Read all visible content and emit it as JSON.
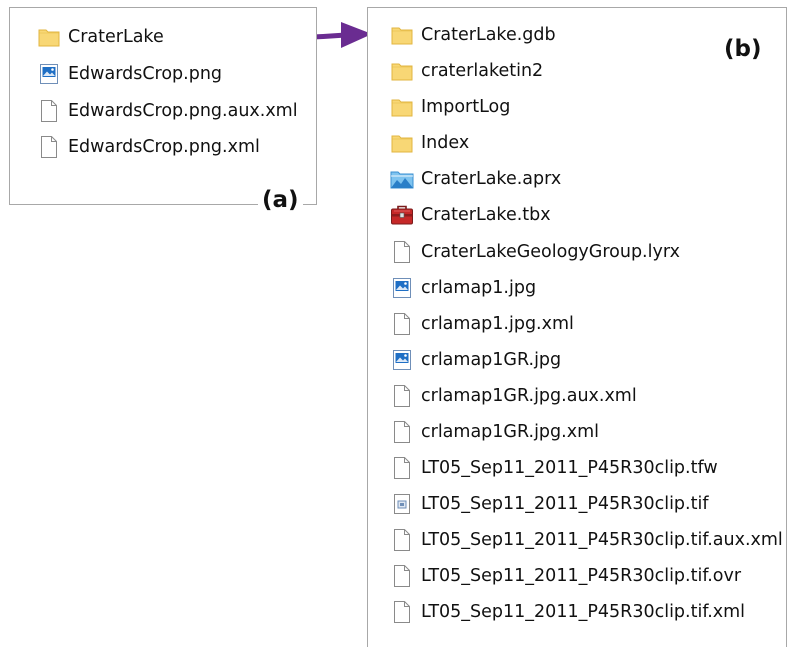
{
  "panel_a": {
    "label": "(a)",
    "items": [
      {
        "name": "CraterLake",
        "icon": "folder-icon"
      },
      {
        "name": "EdwardsCrop.png",
        "icon": "image-file-icon"
      },
      {
        "name": "EdwardsCrop.png.aux.xml",
        "icon": "document-icon"
      },
      {
        "name": "EdwardsCrop.png.xml",
        "icon": "document-icon"
      }
    ]
  },
  "panel_b": {
    "label": "(b)",
    "items": [
      {
        "name": "CraterLake.gdb",
        "icon": "folder-icon"
      },
      {
        "name": "craterlaketin2",
        "icon": "folder-icon"
      },
      {
        "name": "ImportLog",
        "icon": "folder-icon"
      },
      {
        "name": "Index",
        "icon": "folder-icon"
      },
      {
        "name": "CraterLake.aprx",
        "icon": "arcgis-project-icon"
      },
      {
        "name": "CraterLake.tbx",
        "icon": "toolbox-icon"
      },
      {
        "name": "CraterLakeGeologyGroup.lyrx",
        "icon": "document-icon"
      },
      {
        "name": "crlamap1.jpg",
        "icon": "image-file-icon"
      },
      {
        "name": "crlamap1.jpg.xml",
        "icon": "document-icon"
      },
      {
        "name": "crlamap1GR.jpg",
        "icon": "image-file-icon"
      },
      {
        "name": "crlamap1GR.jpg.aux.xml",
        "icon": "document-icon"
      },
      {
        "name": "crlamap1GR.jpg.xml",
        "icon": "document-icon"
      },
      {
        "name": "LT05_Sep11_2011_P45R30clip.tfw",
        "icon": "document-icon"
      },
      {
        "name": "LT05_Sep11_2011_P45R30clip.tif",
        "icon": "raster-file-icon"
      },
      {
        "name": "LT05_Sep11_2011_P45R30clip.tif.aux.xml",
        "icon": "document-icon"
      },
      {
        "name": "LT05_Sep11_2011_P45R30clip.tif.ovr",
        "icon": "document-icon"
      },
      {
        "name": "LT05_Sep11_2011_P45R30clip.tif.xml",
        "icon": "document-icon"
      }
    ]
  },
  "colors": {
    "folder": "#f8d775",
    "folder_edge": "#e2b640",
    "image_blue": "#1f6fc5",
    "arrow": "#6a2c91",
    "toolbox_red": "#c62828",
    "border": "#a8a8a8"
  }
}
